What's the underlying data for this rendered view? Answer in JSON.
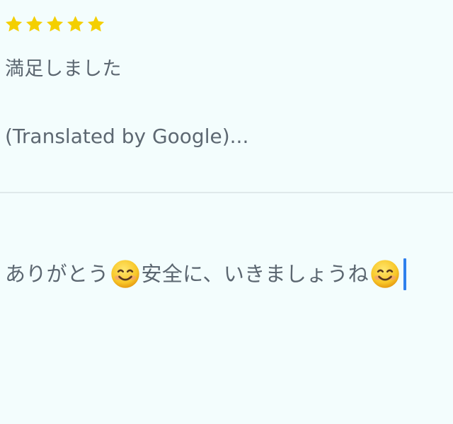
{
  "review": {
    "rating": 5,
    "max_rating": 5,
    "star_color": "#f4cf00",
    "text": "満足しました",
    "translation_note": "(Translated by Google)..."
  },
  "reply": {
    "segment_1": "ありがとう",
    "segment_2": "安全に、いきましょうね",
    "emoji_name": "smiling-face-with-smiling-eyes",
    "caret_color": "#2f80ed"
  },
  "colors": {
    "background": "#f3fdfd",
    "text": "#5b6670",
    "divider": "#dfe9ea"
  }
}
